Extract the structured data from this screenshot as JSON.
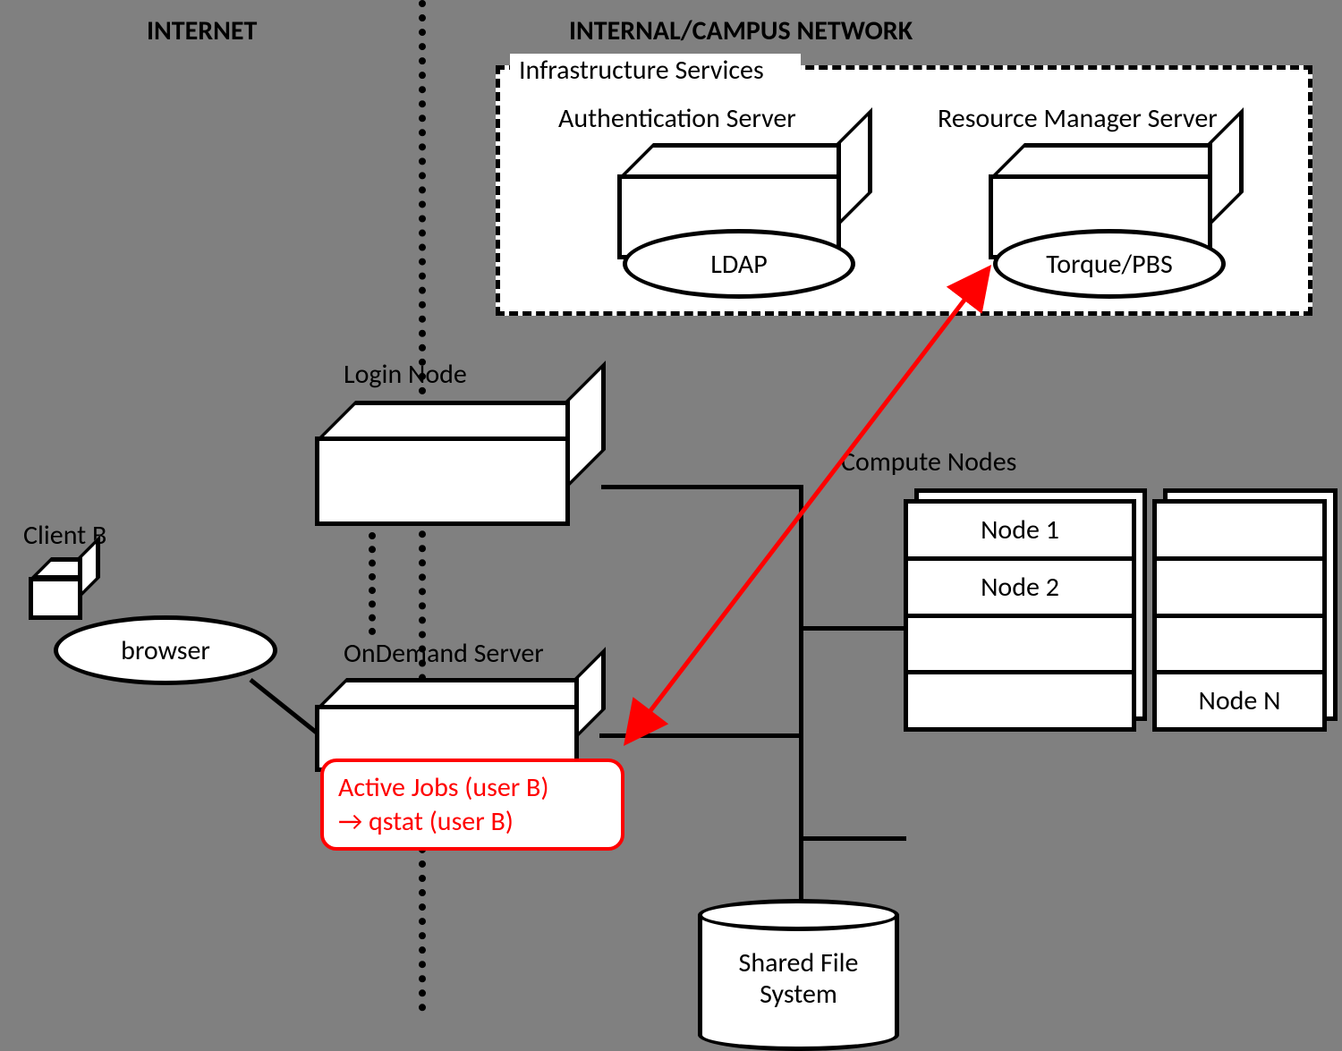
{
  "headers": {
    "internet": "INTERNET",
    "internal": "INTERNAL/CAMPUS NETWORK"
  },
  "infra": {
    "title": "Infrastructure Services",
    "auth_label": "Authentication Server",
    "auth_ellipse": "LDAP",
    "rm_label": "Resource Manager Server",
    "rm_ellipse": "Torque/PBS"
  },
  "login_node": "Login Node",
  "client": {
    "label": "Client B",
    "ellipse": "browser"
  },
  "ondemand": "OnDemand Server",
  "callout": {
    "line1": "Active Jobs (user B)",
    "line2": "→  qstat (user B)"
  },
  "compute": {
    "label": "Compute Nodes",
    "node1": "Node 1",
    "node2": "Node 2",
    "nodeN": "Node N"
  },
  "db": {
    "line1": "Shared File",
    "line2": "System"
  }
}
